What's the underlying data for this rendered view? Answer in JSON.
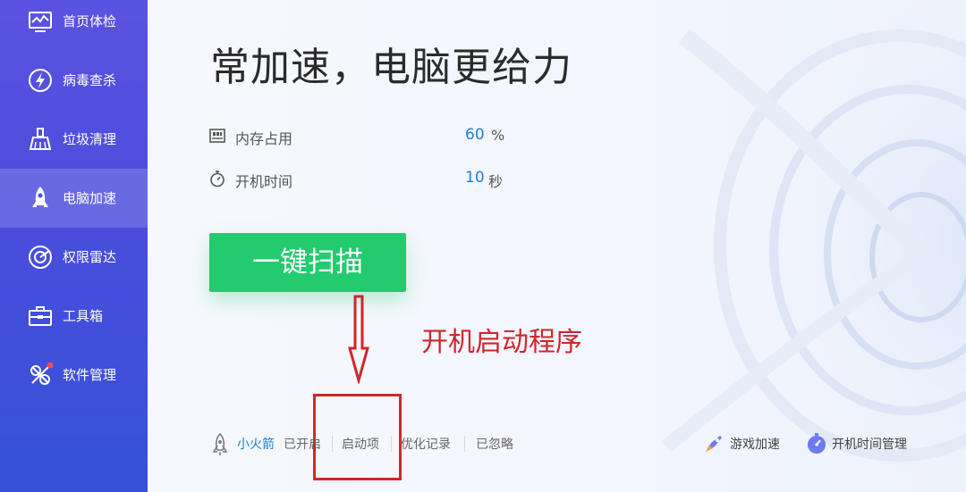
{
  "sidebar": {
    "items": [
      {
        "label": "首页体检",
        "icon": "monitor-icon"
      },
      {
        "label": "病毒查杀",
        "icon": "lightning-shield-icon"
      },
      {
        "label": "垃圾清理",
        "icon": "broom-icon"
      },
      {
        "label": "电脑加速",
        "icon": "rocket-icon",
        "active": true
      },
      {
        "label": "权限雷达",
        "icon": "radar-icon"
      },
      {
        "label": "工具箱",
        "icon": "toolbox-icon"
      },
      {
        "label": "软件管理",
        "icon": "software-icon",
        "badge": true
      }
    ]
  },
  "main": {
    "headline": "常加速，电脑更给力",
    "stats": {
      "memory": {
        "label": "内存占用",
        "value": "60",
        "unit": "%",
        "icon": "memory-icon"
      },
      "boot": {
        "label": "开机时间",
        "value": "10",
        "unit": "秒",
        "icon": "stopwatch-icon"
      }
    },
    "scan_button": "一键扫描"
  },
  "annotation": {
    "text": "开机启动程序"
  },
  "footer": {
    "rocket_name": "小火箭",
    "rocket_status": "已开启",
    "startup": "启动项",
    "optimize_log": "优化记录",
    "ignored": "已忽略",
    "game_boost": "游戏加速",
    "boot_time_manager": "开机时间管理"
  },
  "colors": {
    "sidebar_top": "#5b52e0",
    "sidebar_bottom": "#3552d8",
    "accent_green": "#22cc6e",
    "value_blue": "#1f7fd6",
    "annotation_red": "#d0262a"
  }
}
